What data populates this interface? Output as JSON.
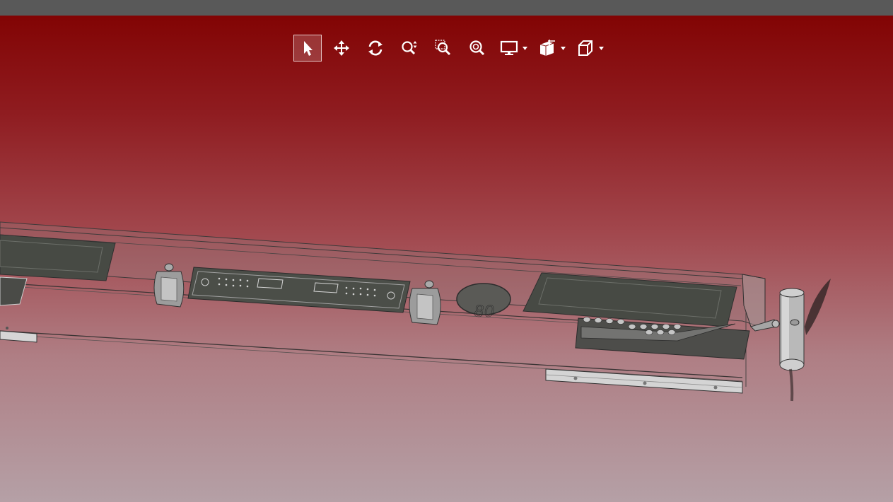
{
  "window": {
    "topbar_color": "#595959",
    "viewport_gradient": [
      "#820404",
      "#b5a0a6"
    ]
  },
  "toolbar": {
    "tools": [
      {
        "id": "select",
        "icon": "cursor-arrow-icon",
        "active": true
      },
      {
        "id": "pan",
        "icon": "pan-arrows-icon",
        "active": false
      },
      {
        "id": "rotate",
        "icon": "rotate-icon",
        "active": false
      },
      {
        "id": "zoom",
        "icon": "zoom-updown-icon",
        "active": false
      },
      {
        "id": "zoom-window",
        "icon": "zoom-window-icon",
        "active": false
      },
      {
        "id": "zoom-fit",
        "icon": "zoom-fit-icon",
        "active": false
      },
      {
        "id": "display",
        "icon": "monitor-icon",
        "dropdown": true
      },
      {
        "id": "section",
        "icon": "section-cube-icon",
        "dropdown": true
      },
      {
        "id": "view",
        "icon": "cube-view-icon",
        "dropdown": true
      }
    ]
  },
  "scene": {
    "model_label": "80"
  }
}
